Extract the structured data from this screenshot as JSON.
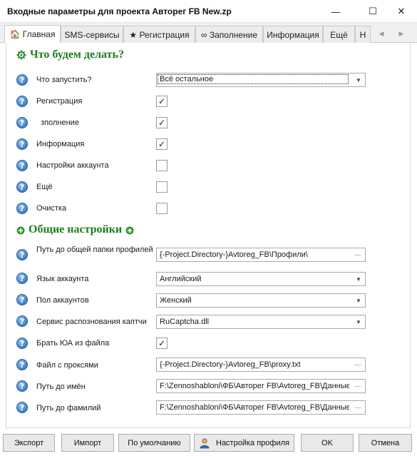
{
  "window": {
    "title": "Входные параметры для проекта Авторег FB New.zp",
    "minimize_glyph": "—",
    "maximize_glyph": "☐",
    "close_glyph": "✕"
  },
  "tabs": [
    {
      "label": "🏠 Главная",
      "active": true
    },
    {
      "label": "SMS-сервисы",
      "active": false
    },
    {
      "label": "★ Регистрация",
      "active": false
    },
    {
      "label": "∞ Заполнение",
      "active": false
    },
    {
      "label": "Информация",
      "active": false
    },
    {
      "label": "Ещё",
      "active": false
    },
    {
      "label": "Н",
      "active": false
    }
  ],
  "tab_scroll": {
    "left": "◀",
    "right": "▶"
  },
  "help_glyph": "?",
  "section1": {
    "title": "Что будем делать?",
    "icon": "gear-icon"
  },
  "section2": {
    "title": "Общие настройки",
    "icon": "plus-circle-icon"
  },
  "rows": {
    "run": {
      "label": "Что запустить?",
      "value": "Всё остальное"
    },
    "registration": {
      "label": "Регистрация",
      "checked": true
    },
    "filling": {
      "label": "  зполнение",
      "checked": true
    },
    "information": {
      "label": "Информация",
      "checked": true
    },
    "account_settings": {
      "label": "Настройки аккаунта",
      "checked": false
    },
    "more": {
      "label": "Ещё",
      "checked": false
    },
    "cleanup": {
      "label": "Очистка",
      "checked": false
    },
    "profiles_path": {
      "label": "Путь до общей папки профилей",
      "value": "{-Project.Directory-}Avtoreg_FB\\Профили\\"
    },
    "account_language": {
      "label": "Язык аккаунта",
      "value": "Английский"
    },
    "account_gender": {
      "label": "Пол аккаунтов",
      "value": "Женский"
    },
    "captcha_service": {
      "label": "Сервис распознования каптчи",
      "value": "RuCaptcha.dll"
    },
    "ua_from_file": {
      "label": "Брать ЮА из файла",
      "checked": true
    },
    "proxy_file": {
      "label": "Файл с проксями",
      "value": "{-Project.Directory-}Avtoreg_FB\\proxy.txt"
    },
    "names_path": {
      "label": "Путь до имён",
      "value": "F:\\Zennoshabloni\\ФБ\\Авторег FB\\Avtoreg_FB\\Данные"
    },
    "surnames_path": {
      "label": "Путь до фамилий",
      "value": "F:\\Zennoshabloni\\ФБ\\Авторег FB\\Avtoreg_FB\\Данные"
    }
  },
  "check_glyph": "✓",
  "dropdown_glyph": "▼",
  "browse_glyph": "···",
  "buttons": {
    "export": "Экспорт",
    "import": "Импорт",
    "defaults": "По умолчанию",
    "profile_settings": "Настройка профиля",
    "ok": "OK",
    "cancel": "Отмена"
  }
}
